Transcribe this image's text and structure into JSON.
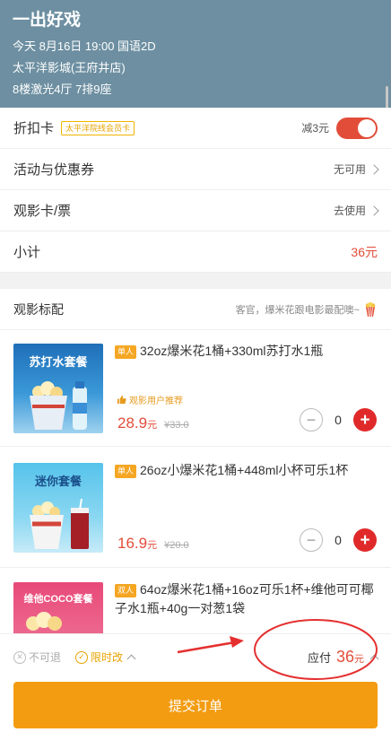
{
  "header": {
    "title": "一出好戏",
    "showtime": "今天 8月16日 19:00 国语2D",
    "cinema": "太平洋影城(王府井店)",
    "seat": "8楼激光4厅 7排9座"
  },
  "discount_card": {
    "label": "折扣卡",
    "badge": "太平洋院线会员卡",
    "value": "减3元",
    "enabled": true
  },
  "coupons": {
    "label": "活动与优惠券",
    "value": "无可用"
  },
  "movie_card": {
    "label": "观影卡/票",
    "value": "去使用"
  },
  "subtotal": {
    "label": "小计",
    "value": "36元"
  },
  "combos": {
    "title": "观影标配",
    "hint": "客官，爆米花跟电影最配噢~",
    "items": [
      {
        "tag": "单人",
        "name": "32oz爆米花1桶+330ml苏打水1瓶",
        "thumb_text": "苏打水套餐",
        "recommend": "观影用户推荐",
        "price": "28.9",
        "unit": "元",
        "old_price": "¥33.0",
        "qty": "0"
      },
      {
        "tag": "单人",
        "name": "26oz小爆米花1桶+448ml小杯可乐1杯",
        "thumb_text": "迷你套餐",
        "price": "16.9",
        "unit": "元",
        "old_price": "¥20.0",
        "qty": "0"
      },
      {
        "tag": "双人",
        "name": "64oz爆米花1桶+16oz可乐1杯+维他可可椰子水1瓶+40g一对葱1袋",
        "thumb_text": "维他COCO套餐"
      }
    ]
  },
  "bottom_bar": {
    "no_refund": "不可退",
    "limited_change": "限时改",
    "total_label": "应付",
    "total_amount": "36",
    "total_unit": "元"
  },
  "submit_label": "提交订单",
  "colors": {
    "header_bg": "#6d8fa1",
    "accent_red": "#e24d3a",
    "submit_orange": "#f39c12"
  }
}
